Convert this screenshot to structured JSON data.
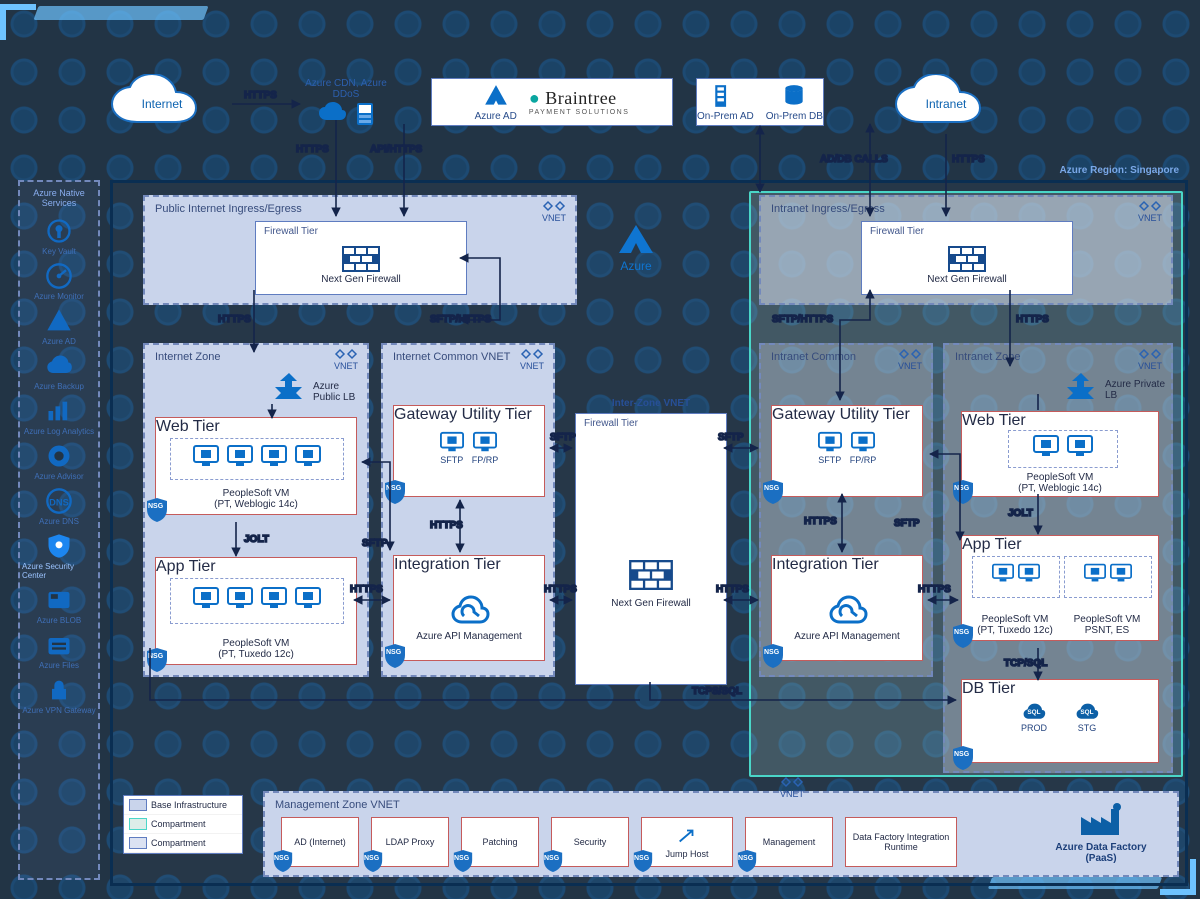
{
  "region_label": "Azure Region: Singapore",
  "clouds": {
    "internet": "Internet",
    "intranet": "Intranet"
  },
  "top": {
    "cdn": "Azure CDN, Azure DDoS",
    "azure_ad": "Azure AD",
    "braintree": "Braintree",
    "braintree_sub": "PAYMENT SOLUTIONS",
    "onprem_ad": "On-Prem AD",
    "onprem_db": "On-Prem DB"
  },
  "sidebar": {
    "title": "Azure Native Services",
    "items": [
      "Key Vault",
      "Azure Monitor",
      "Azure AD",
      "Azure Backup",
      "Azure Log Analytics",
      "Azure Advisor",
      "Azure DNS",
      "Azure Security Center",
      "Azure BLOB",
      "Azure Files",
      "Azure VPN Gateway"
    ]
  },
  "vnets": {
    "public": {
      "title": "Public Internet Ingress/Egress",
      "badge": "VNET",
      "firewall": "Firewall Tier",
      "fw_name": "Next Gen Firewall"
    },
    "intranet_in": {
      "title": "Intranet Ingress/Egress",
      "badge": "VNET",
      "firewall": "Firewall Tier",
      "fw_name": "Next Gen Firewall"
    },
    "izone": {
      "title": "Internet Zone",
      "badge": "VNET",
      "lb": "Azure Public LB",
      "web": {
        "t": "Web Tier",
        "sub": "PeopleSoft VM",
        "sub2": "(PT, Weblogic 14c)"
      },
      "app": {
        "t": "App Tier",
        "sub": "PeopleSoft VM",
        "sub2": "(PT, Tuxedo 12c)"
      }
    },
    "icommon": {
      "title": "Internet Common VNET",
      "badge": "VNET",
      "gw": {
        "t": "Gateway Utility Tier",
        "a": "SFTP",
        "b": "FP/RP"
      },
      "int": {
        "t": "Integration Tier",
        "label": "Azure API Management"
      }
    },
    "inter": {
      "title": "Inter-Zone VNET",
      "fw": "Firewall Tier",
      "fw_name": "Next Gen Firewall"
    },
    "incommon": {
      "title": "Intranet Common",
      "badge": "VNET",
      "gw": {
        "t": "Gateway Utility Tier",
        "a": "SFTP",
        "b": "FP/RP"
      },
      "int": {
        "t": "Integration Tier",
        "label": "Azure API Management"
      }
    },
    "inzone": {
      "title": "Intranet Zone",
      "badge": "VNET",
      "lb": "Azure Private LB",
      "web": {
        "t": "Web Tier",
        "sub": "PeopleSoft VM",
        "sub2": "(PT, Weblogic 14c)"
      },
      "app": {
        "t": "App Tier",
        "sub1": "PeopleSoft VM",
        "sub1b": "(PT, Tuxedo 12c)",
        "sub2": "PeopleSoft VM",
        "sub2b": "PSNT, ES"
      },
      "db": {
        "t": "DB Tier",
        "prod": "PROD",
        "stg": "STG"
      }
    },
    "mgmt": {
      "title": "Management Zone VNET",
      "badge": "VNET",
      "cards": [
        "AD (Internet)",
        "LDAP Proxy",
        "Patching",
        "Security",
        "Jump Host",
        "Management",
        "Data Factory Integration Runtime"
      ],
      "adf": "Azure Data Factory (PaaS)"
    }
  },
  "center": {
    "azure": "Azure"
  },
  "legend": {
    "a": "Base Infrastructure",
    "b": "Compartment",
    "c": "Compartment"
  },
  "labels": {
    "https": "HTTPS",
    "api_https": "API/HTTPS",
    "ad_db": "AD/DB CALLS",
    "sftp_https": "SFTP/HTTPS",
    "jolt": "JOLT",
    "sftp": "SFTP",
    "tcps": "TCPS/SQL",
    "tcp": "TCP/SQL",
    "nsg": "NSG"
  }
}
